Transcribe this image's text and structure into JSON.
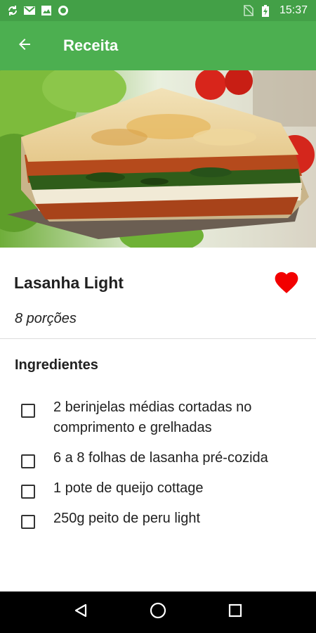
{
  "status_bar": {
    "time": "15:37",
    "left_icons": [
      "sync-icon",
      "gmail-icon",
      "image-icon",
      "record-icon"
    ],
    "right_icons": [
      "no-sim-icon",
      "battery-charging-icon"
    ]
  },
  "app_bar": {
    "title": "Receita",
    "back_icon": "arrow-back-icon",
    "color": "#4caf50"
  },
  "recipe": {
    "name": "Lasanha Light",
    "portions": "8 porções",
    "favorite": true,
    "favorite_color": "#f20000"
  },
  "ingredients": {
    "title": "Ingredientes",
    "items": [
      {
        "text": "2 berinjelas médias cortadas no comprimento e grelhadas",
        "checked": false
      },
      {
        "text": "6 a 8 folhas de lasanha pré-cozida",
        "checked": false
      },
      {
        "text": "1 pote de queijo cottage",
        "checked": false
      },
      {
        "text": "250g peito de peru light",
        "checked": false
      }
    ]
  },
  "nav_bar": {
    "buttons": [
      "back-triangle-icon",
      "home-circle-icon",
      "recents-square-icon"
    ]
  }
}
